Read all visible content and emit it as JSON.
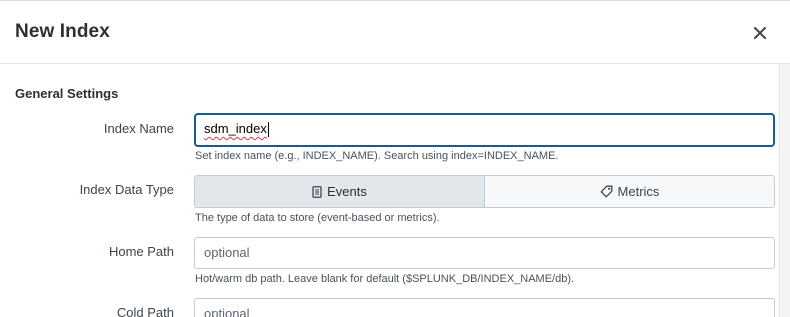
{
  "dialog": {
    "title": "New Index",
    "close_icon": "close-icon"
  },
  "general": {
    "section_title": "General Settings"
  },
  "index_name": {
    "label": "Index Name",
    "value": "sdm_index",
    "help": "Set index name (e.g., INDEX_NAME). Search using index=INDEX_NAME."
  },
  "data_type": {
    "label": "Index Data Type",
    "options": [
      {
        "label": "Events",
        "icon": "document-icon",
        "selected": true
      },
      {
        "label": "Metrics",
        "icon": "tag-icon",
        "selected": false
      }
    ],
    "help": "The type of data to store (event-based or metrics)."
  },
  "home_path": {
    "label": "Home Path",
    "placeholder": "optional",
    "help": "Hot/warm db path. Leave blank for default ($SPLUNK_DB/INDEX_NAME/db)."
  },
  "cold_path": {
    "label": "Cold Path",
    "placeholder": "optional"
  }
}
